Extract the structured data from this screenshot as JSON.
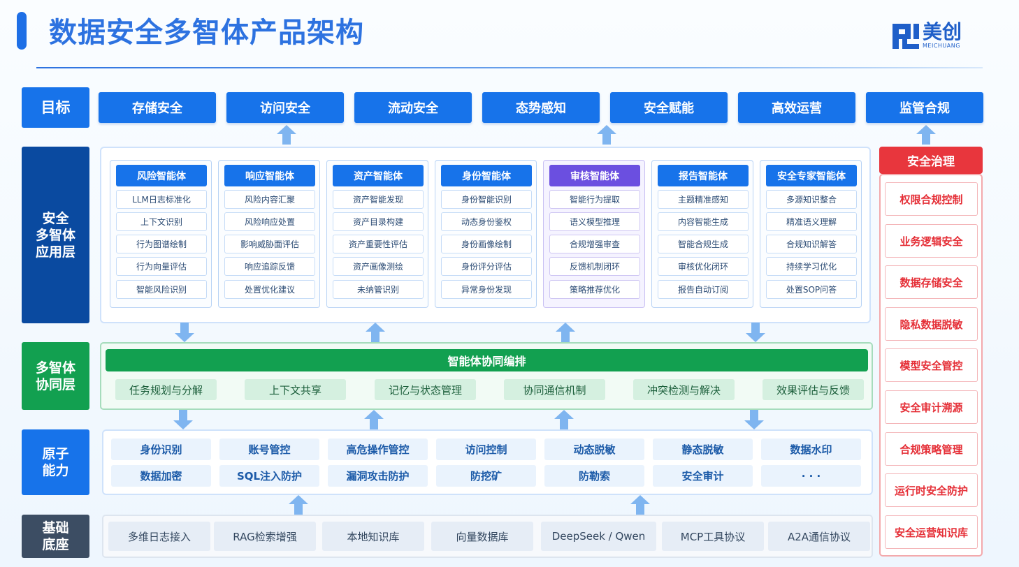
{
  "title": "数据安全多智体产品架构",
  "logo": {
    "cn": "美创",
    "en": "MEICHUANG"
  },
  "layers": {
    "goal": "目标",
    "app": [
      "安全",
      "多智体",
      "应用层"
    ],
    "coord": [
      "多智体",
      "协同层"
    ],
    "atomic": [
      "原子",
      "能力"
    ],
    "base": [
      "基础",
      "底座"
    ]
  },
  "goals": [
    "存储安全",
    "访问安全",
    "流动安全",
    "态势感知",
    "安全赋能",
    "高效运营",
    "监管合规"
  ],
  "agents": [
    {
      "name": "风险智能体",
      "items": [
        "LLM日志标准化",
        "上下文识别",
        "行为图谱绘制",
        "行为向量评估",
        "智能风险识别"
      ]
    },
    {
      "name": "响应智能体",
      "items": [
        "风险内容汇聚",
        "风险响应处置",
        "影响威胁面评估",
        "响应追踪反馈",
        "处置优化建议"
      ]
    },
    {
      "name": "资产智能体",
      "items": [
        "资产智能发现",
        "资产目录构建",
        "资产重要性评估",
        "资产画像测绘",
        "未纳管识别"
      ]
    },
    {
      "name": "身份智能体",
      "items": [
        "身份智能识别",
        "动态身份鉴权",
        "身份画像绘制",
        "身份评分评估",
        "异常身份发现"
      ]
    },
    {
      "name": "审核智能体",
      "items": [
        "智能行为提取",
        "语义模型推理",
        "合规增强审查",
        "反馈机制闭环",
        "策略推荐优化"
      ]
    },
    {
      "name": "报告智能体",
      "items": [
        "主题精准感知",
        "内容智能生成",
        "智能合规生成",
        "审核优化闭环",
        "报告自动订阅"
      ]
    },
    {
      "name": "安全专家智能体",
      "items": [
        "多源知识整合",
        "精准语义理解",
        "合规知识解答",
        "持续学习优化",
        "处置SOP问答"
      ]
    }
  ],
  "coordination": {
    "title": "智能体协同编排",
    "items": [
      "任务规划与分解",
      "上下文共享",
      "记忆与状态管理",
      "协同通信机制",
      "冲突检测与解决",
      "效果评估与反馈"
    ]
  },
  "atomic": [
    [
      "身份识别",
      "账号管控",
      "高危操作管控",
      "访问控制",
      "动态脱敏",
      "静态脱敏",
      "数据水印"
    ],
    [
      "数据加密",
      "SQL注入防护",
      "漏洞攻击防护",
      "防挖矿",
      "防勒索",
      "安全审计",
      "· · ·"
    ]
  ],
  "base": [
    "多维日志接入",
    "RAG检索增强",
    "本地知识库",
    "向量数据库",
    "DeepSeek / Qwen",
    "MCP工具协议",
    "A2A通信协议"
  ],
  "governance": {
    "title": "安全治理",
    "items": [
      "权限合规控制",
      "业务逻辑安全",
      "数据存储安全",
      "隐私数据脱敏",
      "模型安全管控",
      "安全审计溯源",
      "合规策略管理",
      "运行时安全防护",
      "安全运营知识库"
    ]
  },
  "colors": {
    "primary": "#1773ea",
    "dark_label": "#0a4aa0",
    "green": "#12a050",
    "red": "#e8363d",
    "purple": "#6b4fe0",
    "slate": "#3c4d63"
  }
}
